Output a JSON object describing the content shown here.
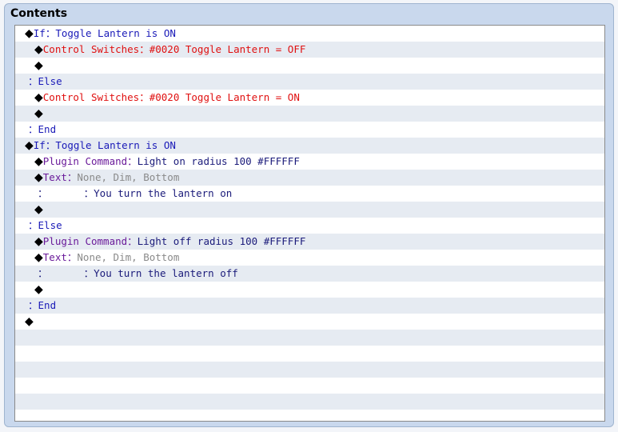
{
  "panel": {
    "title": "Contents"
  },
  "rows": [
    {
      "indent": 0,
      "diamond": true,
      "cmd": "If",
      "cmd_color": "blue",
      "sep": "：",
      "arg": "Toggle Lantern is ON",
      "arg_color": "blue"
    },
    {
      "indent": 1,
      "diamond": true,
      "cmd": "Control Switches",
      "cmd_color": "red",
      "sep": "：",
      "arg": "#0020 Toggle Lantern = OFF",
      "arg_color": "red"
    },
    {
      "indent": 1,
      "diamond": true,
      "cmd": "",
      "cmd_color": "blue",
      "sep": "",
      "arg": "",
      "arg_color": "blue"
    },
    {
      "indent": 0,
      "diamond": false,
      "cmd": "",
      "cmd_color": "blue",
      "sep": "：",
      "arg": "Else",
      "arg_color": "blue"
    },
    {
      "indent": 1,
      "diamond": true,
      "cmd": "Control Switches",
      "cmd_color": "red",
      "sep": "：",
      "arg": "#0020 Toggle Lantern = ON",
      "arg_color": "red"
    },
    {
      "indent": 1,
      "diamond": true,
      "cmd": "",
      "cmd_color": "blue",
      "sep": "",
      "arg": "",
      "arg_color": "blue"
    },
    {
      "indent": 0,
      "diamond": false,
      "cmd": "",
      "cmd_color": "blue",
      "sep": "：",
      "arg": "End",
      "arg_color": "blue"
    },
    {
      "indent": 0,
      "diamond": true,
      "cmd": "If",
      "cmd_color": "blue",
      "sep": "：",
      "arg": "Toggle Lantern is ON",
      "arg_color": "blue"
    },
    {
      "indent": 1,
      "diamond": true,
      "cmd": "Plugin Command",
      "cmd_color": "purple",
      "sep": "：",
      "arg": "Light on radius 100 #FFFFFF",
      "arg_color": "navy"
    },
    {
      "indent": 1,
      "diamond": true,
      "cmd": "Text",
      "cmd_color": "purple",
      "sep": "：",
      "arg": "None, Dim, Bottom",
      "arg_color": "gray"
    },
    {
      "indent": 1,
      "diamond": false,
      "cmd": "",
      "cmd_color": "navy",
      "sep": "：      ：",
      "arg": "You turn the lantern on",
      "arg_color": "navy"
    },
    {
      "indent": 1,
      "diamond": true,
      "cmd": "",
      "cmd_color": "blue",
      "sep": "",
      "arg": "",
      "arg_color": "blue"
    },
    {
      "indent": 0,
      "diamond": false,
      "cmd": "",
      "cmd_color": "blue",
      "sep": "：",
      "arg": "Else",
      "arg_color": "blue"
    },
    {
      "indent": 1,
      "diamond": true,
      "cmd": "Plugin Command",
      "cmd_color": "purple",
      "sep": "：",
      "arg": "Light off radius 100 #FFFFFF",
      "arg_color": "navy"
    },
    {
      "indent": 1,
      "diamond": true,
      "cmd": "Text",
      "cmd_color": "purple",
      "sep": "：",
      "arg": "None, Dim, Bottom",
      "arg_color": "gray"
    },
    {
      "indent": 1,
      "diamond": false,
      "cmd": "",
      "cmd_color": "navy",
      "sep": "：      ：",
      "arg": "You turn the lantern off",
      "arg_color": "navy"
    },
    {
      "indent": 1,
      "diamond": true,
      "cmd": "",
      "cmd_color": "blue",
      "sep": "",
      "arg": "",
      "arg_color": "blue"
    },
    {
      "indent": 0,
      "diamond": false,
      "cmd": "",
      "cmd_color": "blue",
      "sep": "：",
      "arg": "End",
      "arg_color": "blue"
    },
    {
      "indent": 0,
      "diamond": true,
      "cmd": "",
      "cmd_color": "blue",
      "sep": "",
      "arg": "",
      "arg_color": "blue"
    }
  ],
  "empty_rows": 6,
  "icons": {
    "row_marker": "diamond-icon"
  }
}
